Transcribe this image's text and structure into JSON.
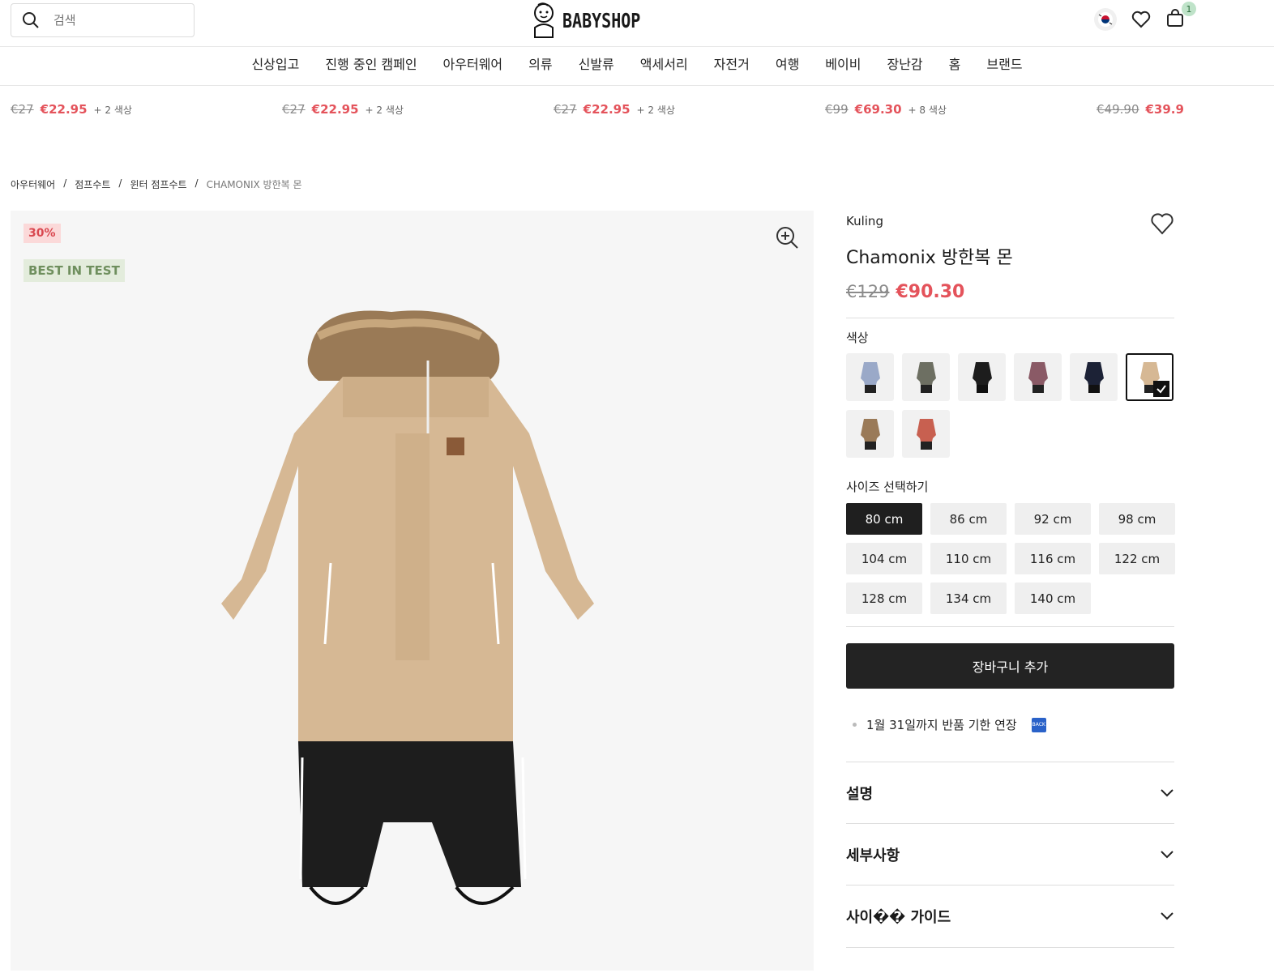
{
  "header": {
    "search_placeholder": "검색",
    "logo_text": "BABYSHOP",
    "cart_count": "1"
  },
  "nav": [
    "신상입고",
    "진행 중인 캠페인",
    "아우터웨어",
    "의류",
    "신발류",
    "액세서리",
    "자전거",
    "여행",
    "베이비",
    "장난감",
    "홈",
    "브랜드"
  ],
  "strip": [
    {
      "old": "€27",
      "new": "€22.95",
      "more": "+ 2 색상"
    },
    {
      "old": "€27",
      "new": "€22.95",
      "more": "+ 2 색상"
    },
    {
      "old": "€27",
      "new": "€22.95",
      "more": "+ 2 색상"
    },
    {
      "old": "€99",
      "new": "€69.30",
      "more": "+ 8 색상"
    },
    {
      "old": "€49.90",
      "new": "€39.9",
      "more": ""
    }
  ],
  "breadcrumb": [
    "아우터웨어",
    "점프수트",
    "윈터 점프수트",
    "CHAMONIX 방한복 몬"
  ],
  "image": {
    "discount_tag": "30%",
    "best_tag": "BEST IN TEST"
  },
  "product": {
    "brand": "Kuling",
    "title": "Chamonix 방한복 몬",
    "old_price": "€129",
    "sale_price": "€90.30",
    "color_label": "색상",
    "size_label": "사이즈 선택하기",
    "sizes": [
      "80 cm",
      "86 cm",
      "92 cm",
      "98 cm",
      "104 cm",
      "110 cm",
      "116 cm",
      "122 cm",
      "128 cm",
      "134 cm",
      "140 cm"
    ],
    "selected_size": "80 cm",
    "add_to_cart": "장바구니 추가",
    "note": "1월 31일까지 반품 기한 연장",
    "back_icon_text": "BACK",
    "accordions": [
      "설명",
      "세부사항",
      "사이�� 가이드"
    ]
  },
  "colors": {
    "swatches": [
      {
        "name": "floral",
        "body": "#9aa9c8",
        "legs": "#222"
      },
      {
        "name": "olive",
        "body": "#6d6f62",
        "legs": "#222"
      },
      {
        "name": "black",
        "body": "#1d1d1d",
        "legs": "#111"
      },
      {
        "name": "mauve",
        "body": "#8a5a66",
        "legs": "#222"
      },
      {
        "name": "navy-print",
        "body": "#1c2236",
        "legs": "#111"
      },
      {
        "name": "beige",
        "body": "#d6b894",
        "legs": "#222"
      },
      {
        "name": "brown",
        "body": "#9a7a58",
        "legs": "#222"
      },
      {
        "name": "rust",
        "body": "#c86050",
        "legs": "#222"
      }
    ],
    "selected_index": 5,
    "sale": "#e4535b",
    "product_beige": "#d6b894"
  }
}
